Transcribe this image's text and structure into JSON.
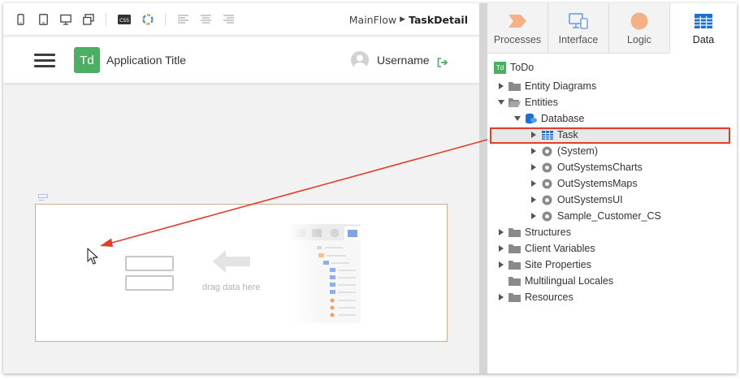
{
  "breadcrumb": {
    "flow": "MainFlow",
    "separator": "▶",
    "screen": "TaskDetail"
  },
  "toolbar": {
    "css_label": "CSS"
  },
  "app": {
    "logo": "Td",
    "title": "Application Title",
    "username": "Username"
  },
  "canvas": {
    "drop_hint": "drag data here"
  },
  "tabs": [
    {
      "label": "Processes",
      "icon": "processes-icon"
    },
    {
      "label": "Interface",
      "icon": "interface-icon"
    },
    {
      "label": "Logic",
      "icon": "logic-icon"
    },
    {
      "label": "Data",
      "icon": "data-icon",
      "active": true
    }
  ],
  "tree": {
    "root": {
      "badge": "Td",
      "label": "ToDo"
    },
    "items": [
      {
        "label": "Entity Diagrams"
      },
      {
        "label": "Entities"
      },
      {
        "label": "Database"
      },
      {
        "label": "Task",
        "selected": true
      },
      {
        "label": "(System)"
      },
      {
        "label": "OutSystemsCharts"
      },
      {
        "label": "OutSystemsMaps"
      },
      {
        "label": "OutSystemsUI"
      },
      {
        "label": "Sample_Customer_CS"
      },
      {
        "label": "Structures"
      },
      {
        "label": "Client Variables"
      },
      {
        "label": "Site Properties"
      },
      {
        "label": "Multilingual Locales"
      },
      {
        "label": "Resources"
      }
    ]
  },
  "colors": {
    "accent_green": "#4caf63",
    "highlight_red": "#e0402a",
    "data_blue": "#1f6fd1",
    "processes_orange": "#f4b183",
    "logic_orange": "#f4b183"
  }
}
